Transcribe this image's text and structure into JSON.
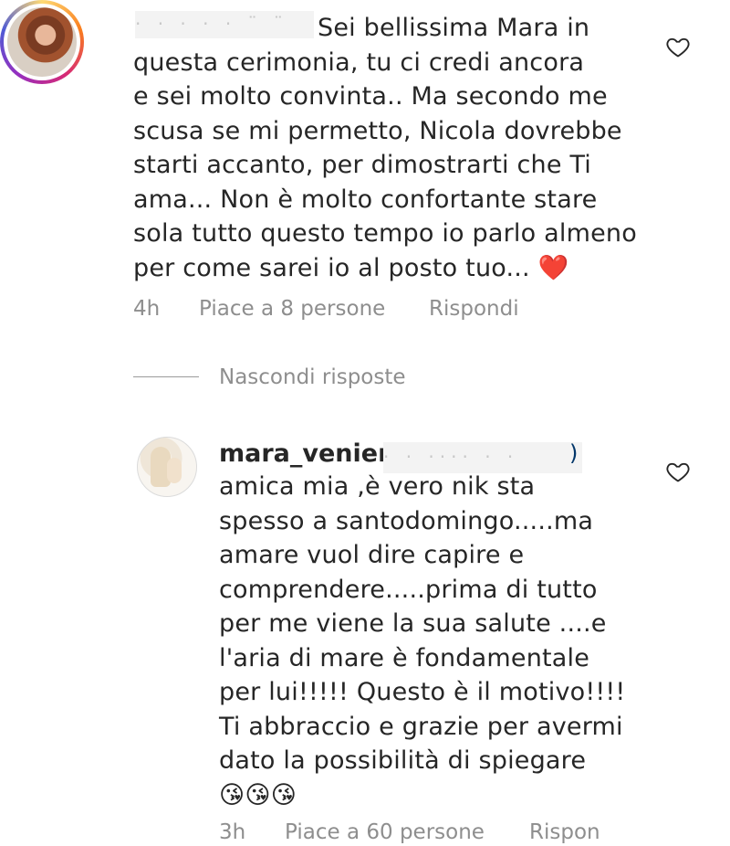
{
  "comment_1": {
    "username_redacted": "· · · · · ¨ ¨",
    "lines": [
      "Sei bellissima Mara  in",
      "questa cerimonia, tu ci credi ancora",
      "e sei molto convinta.. Ma secondo me",
      "scusa se mi permetto, Nicola dovrebbe",
      "starti accanto, per dimostrarti che Ti",
      "ama... Non è molto confortante stare",
      "sola tutto questo tempo io parlo almeno",
      "per come sarei io al posto tuo... ❤️"
    ],
    "time": "4h",
    "likes": "Piace a 8 persone",
    "reply": "Rispondi",
    "like_icon": "heart-outline-icon"
  },
  "replies_toggle": {
    "label": "Nascondi risposte"
  },
  "comment_2": {
    "username": "mara_venier",
    "mention_redacted": "· · ···· · ·",
    "mention_start": "@",
    "mention_end": ")",
    "lines": [
      "amica mia ,è vero nik sta",
      "spesso a santodomingo.....ma",
      "amare vuol dire capire e",
      "comprendere.....prima di tutto",
      "per me viene la sua salute ....e",
      "l'aria di mare è fondamentale",
      "per lui!!!!! Questo è il motivo!!!!",
      "Ti abbraccio e grazie per avermi",
      "dato la possibilità di spiegare",
      "😘😘😘"
    ],
    "time": "3h",
    "likes": "Piace a 60 persone",
    "reply": "Rispon",
    "like_icon": "heart-outline-icon"
  },
  "colors": {
    "text": "#262626",
    "meta": "#8e8e8e",
    "mention": "#003569"
  }
}
